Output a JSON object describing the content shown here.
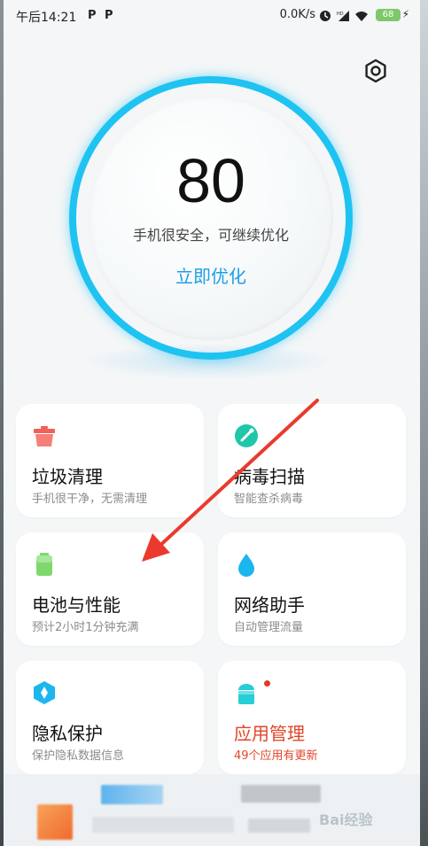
{
  "status_bar": {
    "time": "午后14:21",
    "p1": "P",
    "p2": "P",
    "network_speed": "0.0K/s",
    "hd_label": "HD",
    "battery_level": "68",
    "battery_color": "#7ec86a"
  },
  "score": {
    "value": "80",
    "status_text": "手机很安全，可继续优化",
    "action_label": "立即优化",
    "accent_color": "#1ec3f2"
  },
  "cards": [
    {
      "title": "垃圾清理",
      "subtitle": "手机很干净，无需清理",
      "icon": "trash-icon",
      "color": "#f0615a"
    },
    {
      "title": "病毒扫描",
      "subtitle": "智能查杀病毒",
      "icon": "shield-scan-icon",
      "color": "#1fc7a8"
    },
    {
      "title": "电池与性能",
      "subtitle": "预计2小时1分钟充满",
      "icon": "battery-icon",
      "color": "#7ed96d"
    },
    {
      "title": "网络助手",
      "subtitle": "自动管理流量",
      "icon": "water-drop-icon",
      "color": "#1bb6ee"
    },
    {
      "title": "隐私保护",
      "subtitle": "保护隐私数据信息",
      "icon": "privacy-hex-icon",
      "color": "#1bb6ee"
    },
    {
      "title": "应用管理",
      "subtitle": "49个应用有更新",
      "icon": "android-app-icon",
      "color": "#27cdd8",
      "alert_color": "#e2452b"
    }
  ],
  "watermark": "Bai经验"
}
